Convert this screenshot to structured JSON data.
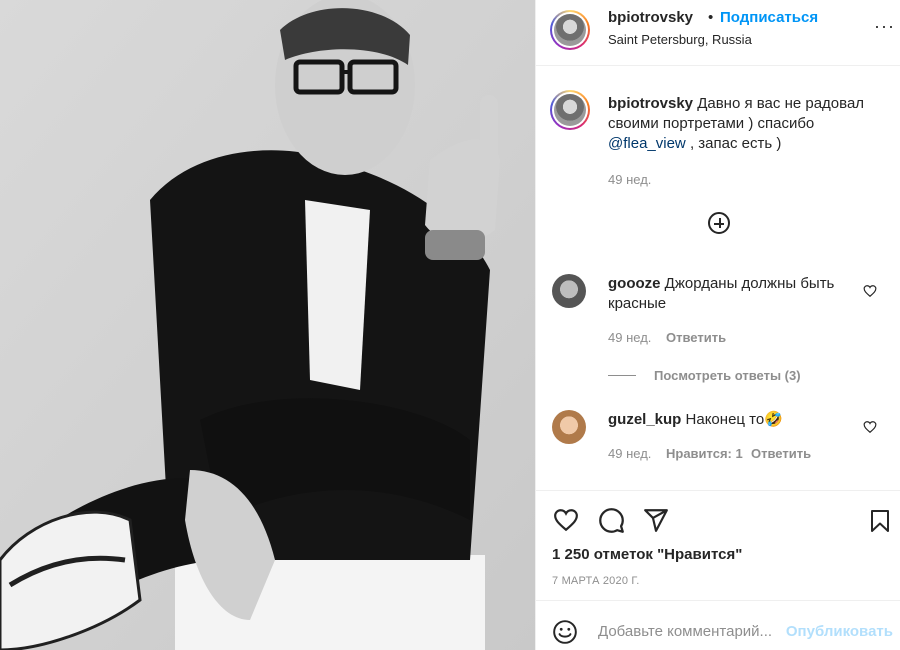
{
  "post": {
    "username": "bpiotrovsky",
    "follow_label": "Подписаться",
    "separator": "•",
    "location": "Saint Petersburg, Russia",
    "more_label": "···"
  },
  "caption": {
    "username": "bpiotrovsky",
    "text_before": "Давно я вас не радовал своими портретами ) спасибо",
    "mention": "@flea_view",
    "text_after": ", запас есть )",
    "time": "49 нед."
  },
  "comments": [
    {
      "username": "goooze",
      "text": "Джорданы должны быть красные",
      "time": "49 нед.",
      "reply_label": "Ответить",
      "view_replies_label": "Посмотреть ответы (3)"
    },
    {
      "username": "guzel_kup",
      "text": "Наконец то",
      "emoji": "🤣",
      "time": "49 нед.",
      "likes_label": "Нравится: 1",
      "reply_label": "Ответить"
    }
  ],
  "stats": {
    "likes": "1 250 отметок \"Нравится\"",
    "date": "7 МАРТА 2020 Г."
  },
  "comment_box": {
    "placeholder": "Добавьте комментарий...",
    "publish_label": "Опубликовать"
  },
  "icons": {
    "like": "heart-icon",
    "comment": "comment-icon",
    "share": "paper-plane-icon",
    "save": "bookmark-icon",
    "add_comments": "plus-circle-icon",
    "emoji": "emoji-icon"
  },
  "colors": {
    "link": "#0095f6",
    "muted": "#8e8e8e",
    "text": "#262626",
    "publish_disabled": "#b2dffc"
  }
}
